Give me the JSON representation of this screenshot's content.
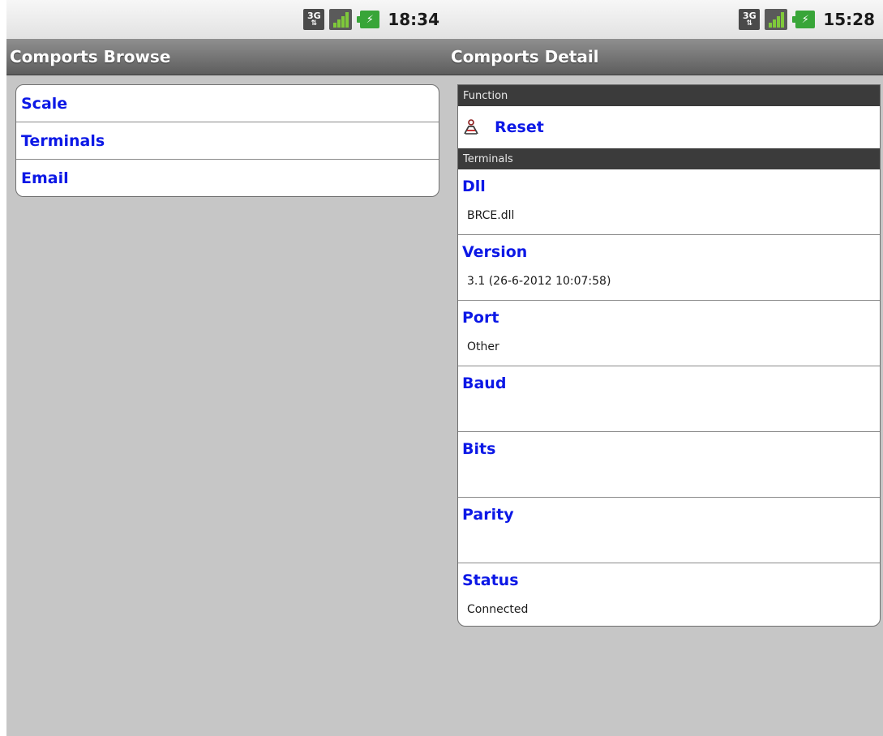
{
  "left": {
    "status_time": "18:34",
    "network_label": "3G",
    "title": "Comports Browse",
    "items": [
      {
        "label": "Scale"
      },
      {
        "label": "Terminals"
      },
      {
        "label": "Email"
      }
    ]
  },
  "right": {
    "status_time": "15:28",
    "network_label": "3G",
    "title": "Comports Detail",
    "function_header": "Function",
    "reset_label": "Reset",
    "terminals_header": "Terminals",
    "fields": [
      {
        "label": "Dll",
        "value": "BRCE.dll"
      },
      {
        "label": "Version",
        "value": "3.1 (26-6-2012 10:07:58)"
      },
      {
        "label": "Port",
        "value": "Other"
      },
      {
        "label": "Baud",
        "value": ""
      },
      {
        "label": "Bits",
        "value": ""
      },
      {
        "label": "Parity",
        "value": ""
      },
      {
        "label": "Status",
        "value": "Connected"
      }
    ]
  },
  "colors": {
    "link_blue": "#0c18e6",
    "background_gray": "#c6c6c6",
    "header_dark": "#3b3b3b",
    "battery_green": "#38a538"
  },
  "icons": [
    "3g-icon",
    "signal-icon",
    "battery-charging-icon",
    "reset-icon"
  ]
}
